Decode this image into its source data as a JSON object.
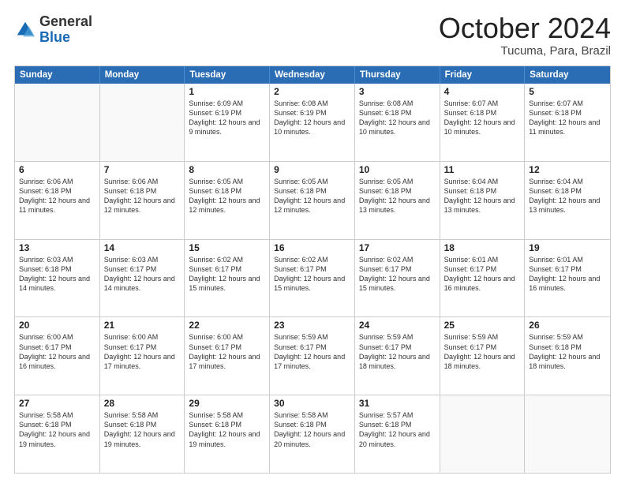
{
  "header": {
    "logo": {
      "general": "General",
      "blue": "Blue"
    },
    "month": "October 2024",
    "location": "Tucuma, Para, Brazil"
  },
  "weekdays": [
    "Sunday",
    "Monday",
    "Tuesday",
    "Wednesday",
    "Thursday",
    "Friday",
    "Saturday"
  ],
  "weeks": [
    [
      {
        "day": "",
        "empty": true
      },
      {
        "day": "",
        "empty": true
      },
      {
        "day": "1",
        "sunrise": "Sunrise: 6:09 AM",
        "sunset": "Sunset: 6:19 PM",
        "daylight": "Daylight: 12 hours and 9 minutes."
      },
      {
        "day": "2",
        "sunrise": "Sunrise: 6:08 AM",
        "sunset": "Sunset: 6:19 PM",
        "daylight": "Daylight: 12 hours and 10 minutes."
      },
      {
        "day": "3",
        "sunrise": "Sunrise: 6:08 AM",
        "sunset": "Sunset: 6:18 PM",
        "daylight": "Daylight: 12 hours and 10 minutes."
      },
      {
        "day": "4",
        "sunrise": "Sunrise: 6:07 AM",
        "sunset": "Sunset: 6:18 PM",
        "daylight": "Daylight: 12 hours and 10 minutes."
      },
      {
        "day": "5",
        "sunrise": "Sunrise: 6:07 AM",
        "sunset": "Sunset: 6:18 PM",
        "daylight": "Daylight: 12 hours and 11 minutes."
      }
    ],
    [
      {
        "day": "6",
        "sunrise": "Sunrise: 6:06 AM",
        "sunset": "Sunset: 6:18 PM",
        "daylight": "Daylight: 12 hours and 11 minutes."
      },
      {
        "day": "7",
        "sunrise": "Sunrise: 6:06 AM",
        "sunset": "Sunset: 6:18 PM",
        "daylight": "Daylight: 12 hours and 12 minutes."
      },
      {
        "day": "8",
        "sunrise": "Sunrise: 6:05 AM",
        "sunset": "Sunset: 6:18 PM",
        "daylight": "Daylight: 12 hours and 12 minutes."
      },
      {
        "day": "9",
        "sunrise": "Sunrise: 6:05 AM",
        "sunset": "Sunset: 6:18 PM",
        "daylight": "Daylight: 12 hours and 12 minutes."
      },
      {
        "day": "10",
        "sunrise": "Sunrise: 6:05 AM",
        "sunset": "Sunset: 6:18 PM",
        "daylight": "Daylight: 12 hours and 13 minutes."
      },
      {
        "day": "11",
        "sunrise": "Sunrise: 6:04 AM",
        "sunset": "Sunset: 6:18 PM",
        "daylight": "Daylight: 12 hours and 13 minutes."
      },
      {
        "day": "12",
        "sunrise": "Sunrise: 6:04 AM",
        "sunset": "Sunset: 6:18 PM",
        "daylight": "Daylight: 12 hours and 13 minutes."
      }
    ],
    [
      {
        "day": "13",
        "sunrise": "Sunrise: 6:03 AM",
        "sunset": "Sunset: 6:18 PM",
        "daylight": "Daylight: 12 hours and 14 minutes."
      },
      {
        "day": "14",
        "sunrise": "Sunrise: 6:03 AM",
        "sunset": "Sunset: 6:17 PM",
        "daylight": "Daylight: 12 hours and 14 minutes."
      },
      {
        "day": "15",
        "sunrise": "Sunrise: 6:02 AM",
        "sunset": "Sunset: 6:17 PM",
        "daylight": "Daylight: 12 hours and 15 minutes."
      },
      {
        "day": "16",
        "sunrise": "Sunrise: 6:02 AM",
        "sunset": "Sunset: 6:17 PM",
        "daylight": "Daylight: 12 hours and 15 minutes."
      },
      {
        "day": "17",
        "sunrise": "Sunrise: 6:02 AM",
        "sunset": "Sunset: 6:17 PM",
        "daylight": "Daylight: 12 hours and 15 minutes."
      },
      {
        "day": "18",
        "sunrise": "Sunrise: 6:01 AM",
        "sunset": "Sunset: 6:17 PM",
        "daylight": "Daylight: 12 hours and 16 minutes."
      },
      {
        "day": "19",
        "sunrise": "Sunrise: 6:01 AM",
        "sunset": "Sunset: 6:17 PM",
        "daylight": "Daylight: 12 hours and 16 minutes."
      }
    ],
    [
      {
        "day": "20",
        "sunrise": "Sunrise: 6:00 AM",
        "sunset": "Sunset: 6:17 PM",
        "daylight": "Daylight: 12 hours and 16 minutes."
      },
      {
        "day": "21",
        "sunrise": "Sunrise: 6:00 AM",
        "sunset": "Sunset: 6:17 PM",
        "daylight": "Daylight: 12 hours and 17 minutes."
      },
      {
        "day": "22",
        "sunrise": "Sunrise: 6:00 AM",
        "sunset": "Sunset: 6:17 PM",
        "daylight": "Daylight: 12 hours and 17 minutes."
      },
      {
        "day": "23",
        "sunrise": "Sunrise: 5:59 AM",
        "sunset": "Sunset: 6:17 PM",
        "daylight": "Daylight: 12 hours and 17 minutes."
      },
      {
        "day": "24",
        "sunrise": "Sunrise: 5:59 AM",
        "sunset": "Sunset: 6:17 PM",
        "daylight": "Daylight: 12 hours and 18 minutes."
      },
      {
        "day": "25",
        "sunrise": "Sunrise: 5:59 AM",
        "sunset": "Sunset: 6:17 PM",
        "daylight": "Daylight: 12 hours and 18 minutes."
      },
      {
        "day": "26",
        "sunrise": "Sunrise: 5:59 AM",
        "sunset": "Sunset: 6:18 PM",
        "daylight": "Daylight: 12 hours and 18 minutes."
      }
    ],
    [
      {
        "day": "27",
        "sunrise": "Sunrise: 5:58 AM",
        "sunset": "Sunset: 6:18 PM",
        "daylight": "Daylight: 12 hours and 19 minutes."
      },
      {
        "day": "28",
        "sunrise": "Sunrise: 5:58 AM",
        "sunset": "Sunset: 6:18 PM",
        "daylight": "Daylight: 12 hours and 19 minutes."
      },
      {
        "day": "29",
        "sunrise": "Sunrise: 5:58 AM",
        "sunset": "Sunset: 6:18 PM",
        "daylight": "Daylight: 12 hours and 19 minutes."
      },
      {
        "day": "30",
        "sunrise": "Sunrise: 5:58 AM",
        "sunset": "Sunset: 6:18 PM",
        "daylight": "Daylight: 12 hours and 20 minutes."
      },
      {
        "day": "31",
        "sunrise": "Sunrise: 5:57 AM",
        "sunset": "Sunset: 6:18 PM",
        "daylight": "Daylight: 12 hours and 20 minutes."
      },
      {
        "day": "",
        "empty": true
      },
      {
        "day": "",
        "empty": true
      }
    ]
  ]
}
